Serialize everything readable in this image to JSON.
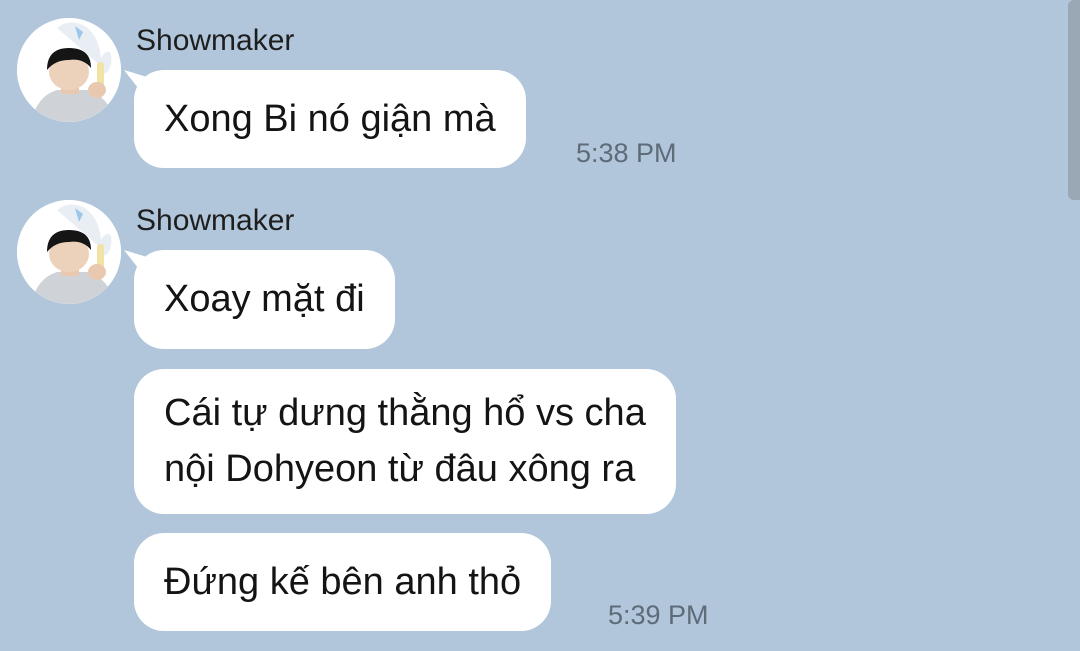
{
  "messages": [
    {
      "sender": "Showmaker",
      "avatar_icon": "profile-photo",
      "lines": [
        {
          "text": "Xong Bi nó giận mà",
          "time": "5:38 PM"
        }
      ]
    },
    {
      "sender": "Showmaker",
      "avatar_icon": "profile-photo",
      "lines": [
        {
          "text": "Xoay mặt đi",
          "time": ""
        },
        {
          "text": "Cái tự dưng thằng hổ vs cha\nnội Dohyeon từ đâu xông ra",
          "time": ""
        },
        {
          "text": "Đứng kế bên anh thỏ",
          "time": "5:39 PM"
        }
      ]
    }
  ],
  "colors": {
    "background": "#b1c6db",
    "bubble": "#ffffff",
    "time": "#5e6b78"
  }
}
